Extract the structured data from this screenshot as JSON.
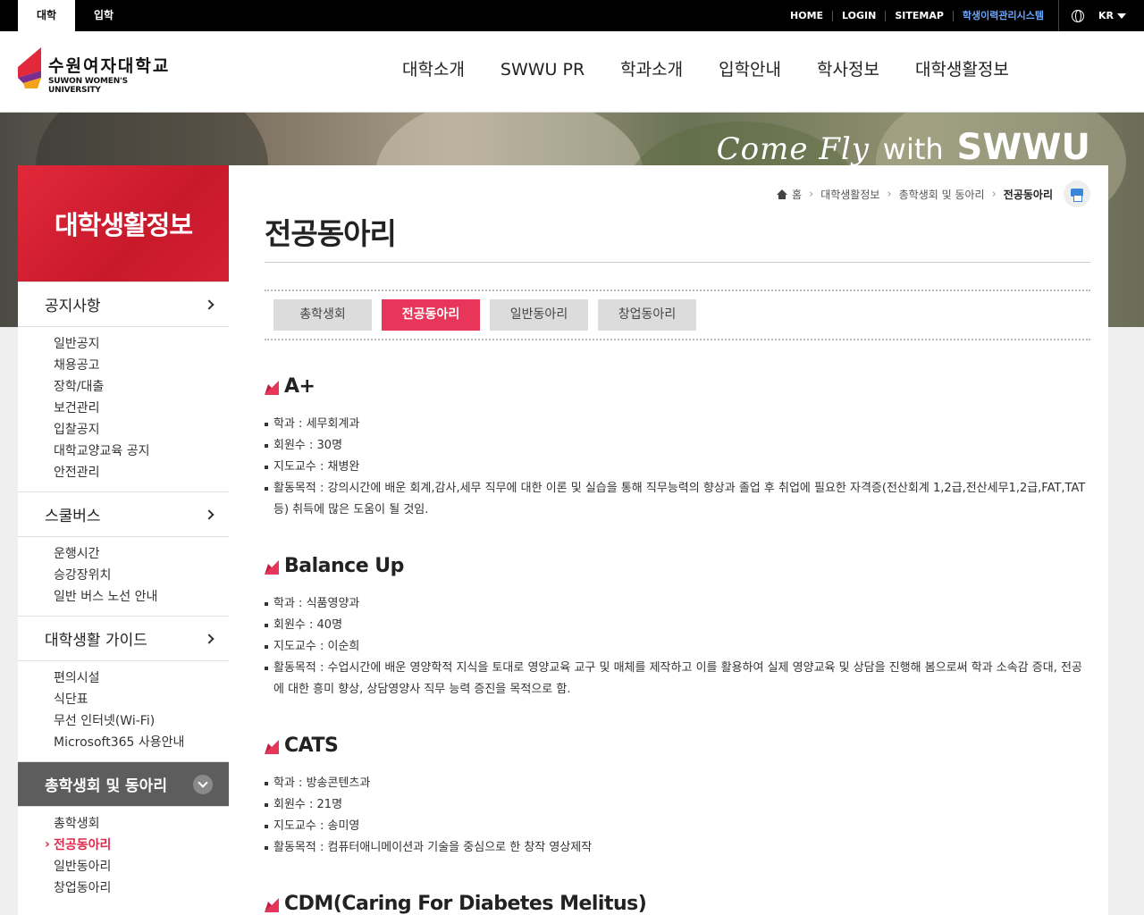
{
  "topbar": {
    "tabs": [
      {
        "label": "대학"
      },
      {
        "label": "입학"
      }
    ],
    "links": [
      {
        "label": "HOME"
      },
      {
        "label": "LOGIN"
      },
      {
        "label": "SITEMAP"
      },
      {
        "label": "학생이력관리시스템"
      }
    ],
    "lang": "KR"
  },
  "header": {
    "logo_ko": "수원여자대학교",
    "logo_en": "SUWON WOMEN'S UNIVERSITY",
    "nav": [
      {
        "label": "대학소개"
      },
      {
        "label": "SWWU PR"
      },
      {
        "label": "학과소개"
      },
      {
        "label": "입학안내"
      },
      {
        "label": "학사정보"
      },
      {
        "label": "대학생활정보"
      }
    ]
  },
  "banner": {
    "script": "Come Fly",
    "with": "with",
    "brand": "SWWU"
  },
  "sidebar": {
    "title": "대학생활정보",
    "groups": [
      {
        "label": "공지사항",
        "items": [
          "일반공지",
          "채용공고",
          "장학/대출",
          "보건관리",
          "입찰공지",
          "대학교양교육 공지",
          "안전관리"
        ]
      },
      {
        "label": "스쿨버스",
        "items": [
          "운행시간",
          "승강장위치",
          "일반 버스 노선 안내"
        ]
      },
      {
        "label": "대학생활 가이드",
        "items": [
          "편의시설",
          "식단표",
          "무선 인터넷(Wi-Fi)",
          "Microsoft365 사용안내"
        ]
      },
      {
        "label": "총학생회 및 동아리",
        "items": [
          "총학생회",
          "전공동아리",
          "일반동아리",
          "창업동아리"
        ]
      }
    ]
  },
  "breadcrumb": {
    "home": "홈",
    "l1": "대학생활정보",
    "l2": "총학생회 및 동아리",
    "current": "전공동아리"
  },
  "page": {
    "title": "전공동아리",
    "tabs": [
      {
        "label": "총학생회"
      },
      {
        "label": "전공동아리"
      },
      {
        "label": "일반동아리"
      },
      {
        "label": "창업동아리"
      }
    ],
    "clubs": [
      {
        "name": "A+",
        "lines": [
          "학과 : 세무회계과",
          "회원수 : 30명",
          "지도교수 : 채병완",
          "활동목적 : 강의시간에 배운 회계,감사,세무 직무에 대한 이론 및 실습을 통해 직무능력의 향상과 졸업 후 취업에 필요한 자격증(전산회계 1,2급,전산세무1,2급,FAT,TAT 등) 취득에 많은 도움이 될 것임."
        ]
      },
      {
        "name": "Balance Up",
        "lines": [
          "학과 : 식품영양과",
          "회원수 : 40명",
          "지도교수 : 이순희",
          "활동목적 : 수업시간에 배운 영양학적 지식을 토대로 영양교육 교구 및 매체를 제작하고 이를 활용하여 실제 영양교육 및 상담을 진행해 봄으로써 학과 소속감 증대, 전공에 대한 흥미 향상, 상담영양사 직무 능력 증진을 목적으로 함."
        ]
      },
      {
        "name": "CATS",
        "lines": [
          "학과 : 방송콘텐츠과",
          "회원수 : 21명",
          "지도교수 : 송미영",
          "활동목적 : 컴퓨터애니메이션과 기술을 중심으로 한 창작 영상제작"
        ]
      },
      {
        "name": "CDM(Caring For Diabetes Melitus)",
        "lines": []
      }
    ]
  },
  "colors": {
    "accent": "#e8355a",
    "side_red": "#d42033",
    "active_gray": "#5d5d5d",
    "link_blue": "#6aa7ff"
  }
}
